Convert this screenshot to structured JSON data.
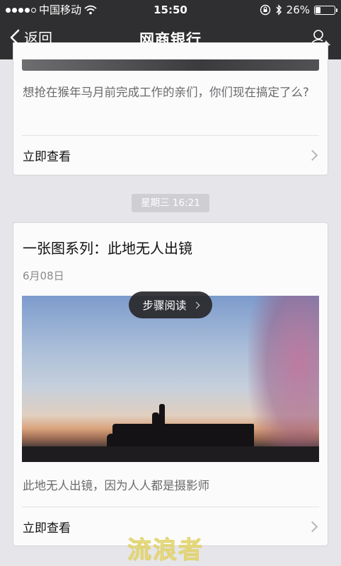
{
  "status_bar": {
    "carrier": "中国移动",
    "time": "15:50",
    "battery": "26%",
    "battery_level": 0.26,
    "icons": [
      "signal-dots",
      "wifi-icon",
      "lock-rotation-icon",
      "bluetooth-icon",
      "battery-icon"
    ]
  },
  "nav": {
    "back_label": "返回",
    "title": "网商银行",
    "right_icon": "profile-settings-icon"
  },
  "feed": {
    "card1": {
      "description": "想抢在猴年马月前完成工作的亲们，你们现在搞定了么?",
      "action_label": "立即查看"
    },
    "timestamp": "星期三 16:21",
    "card2": {
      "title": "一张图系列：此地无人出镜",
      "date": "6月08日",
      "step_read_label": "步骤阅读",
      "description": "此地无人出镜，因为人人都是摄影师",
      "action_label": "立即查看"
    }
  },
  "watermark": "流浪者",
  "colors": {
    "topbar": "#2f2f31",
    "background": "#e6e5ea",
    "card": "#fbfbfb",
    "muted_text": "#6a6a6d"
  }
}
